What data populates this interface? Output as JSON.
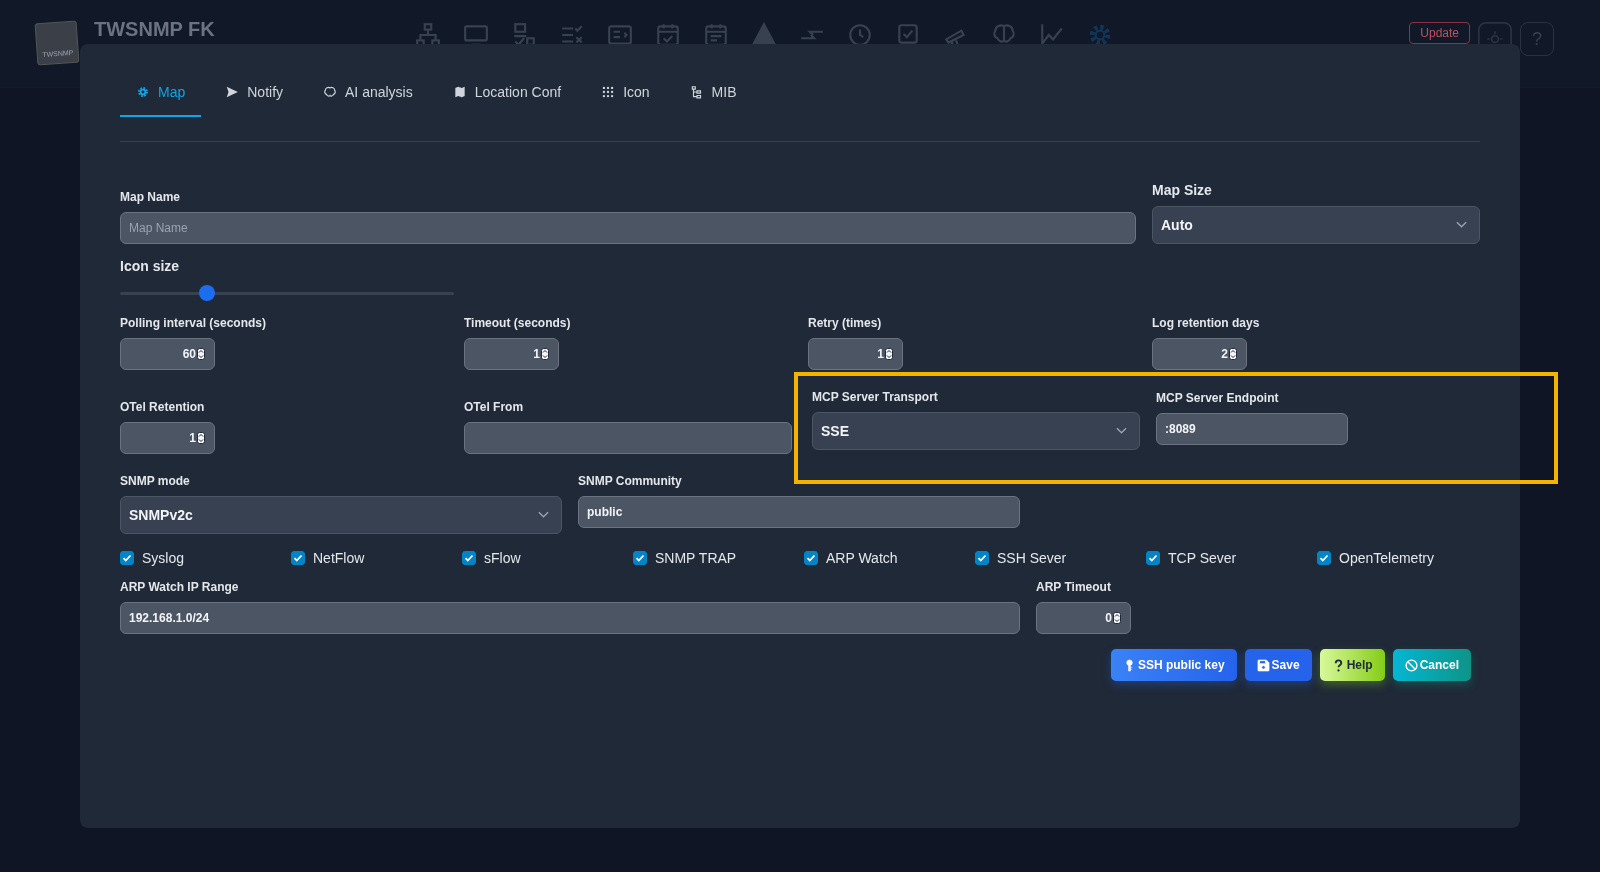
{
  "app_header": {
    "title": "TWSNMP FK",
    "logo_text": "TWSNMP",
    "update_button": "Update",
    "help_button": "?"
  },
  "dialog": {
    "tabs": [
      {
        "label": "Map",
        "selected": true
      },
      {
        "label": "Notify",
        "selected": false
      },
      {
        "label": "AI analysis",
        "selected": false
      },
      {
        "label": "Location Conf",
        "selected": false
      },
      {
        "label": "Icon",
        "selected": false
      },
      {
        "label": "MIB",
        "selected": false
      }
    ],
    "map_name": {
      "label": "Map Name",
      "placeholder": "Map Name"
    },
    "map_size": {
      "label": "Map Size",
      "value": "Auto"
    },
    "icon_size": {
      "label": "Icon size",
      "level": 0.26
    },
    "number_fields": [
      {
        "label": "Polling interval (seconds)",
        "value": "60"
      },
      {
        "label": "Timeout (seconds)",
        "value": "1"
      },
      {
        "label": "Retry (times)",
        "value": "1"
      },
      {
        "label": "Log retention days",
        "value": "2"
      }
    ],
    "otel_retention": {
      "label": "OTel Retention",
      "value": "1"
    },
    "otel_from": {
      "label": "OTel From"
    },
    "mcp": {
      "highlighted": true,
      "transport": {
        "label": "MCP Server Transport",
        "value": "SSE"
      },
      "endpoint": {
        "label": "MCP Server Endpoint",
        "value": ":8089"
      }
    },
    "snmp_mode": {
      "label": "SNMP mode",
      "value": "SNMPv2c"
    },
    "snmp_community": {
      "label": "SNMP Community",
      "value": "public"
    },
    "services": [
      {
        "label": "Syslog",
        "checked": true
      },
      {
        "label": "NetFlow",
        "checked": true
      },
      {
        "label": "sFlow",
        "checked": true
      },
      {
        "label": "SNMP TRAP",
        "checked": true
      },
      {
        "label": "ARP Watch",
        "checked": true
      },
      {
        "label": "SSH Sever",
        "checked": true
      },
      {
        "label": "TCP Sever",
        "checked": true
      },
      {
        "label": "OpenTelemetry",
        "checked": true
      }
    ],
    "arp_range": {
      "label": "ARP Watch IP Range",
      "value": "192.168.1.0/24"
    },
    "arp_timeout": {
      "label": "ARP Timeout",
      "value": "0"
    },
    "buttons": [
      {
        "label": "SSH public key",
        "kind": "key"
      },
      {
        "label": "Save",
        "kind": "save"
      },
      {
        "label": "Help",
        "kind": "help"
      },
      {
        "label": "Cancel",
        "kind": "cancel"
      }
    ]
  }
}
